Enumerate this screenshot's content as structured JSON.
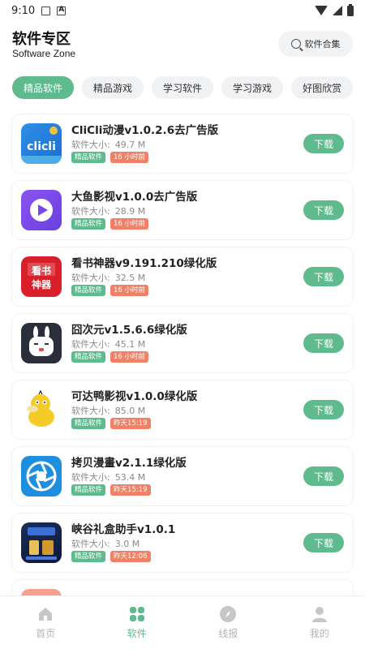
{
  "statusbar": {
    "time": "9:10"
  },
  "header": {
    "title": "软件专区",
    "subtitle": "Software Zone",
    "search_label": "软件合集"
  },
  "tabs": [
    {
      "label": "精品软件",
      "active": true
    },
    {
      "label": "精品游戏",
      "active": false
    },
    {
      "label": "学习软件",
      "active": false
    },
    {
      "label": "学习游戏",
      "active": false
    },
    {
      "label": "好图欣赏",
      "active": false
    }
  ],
  "apps": [
    {
      "name": "CliCli动漫v1.0.2.6去广告版",
      "size_label": "软件大小:",
      "size": "49.7 M",
      "category": "精品软件",
      "time": "16 小时前",
      "download": "下载",
      "icon": "clicli-icon"
    },
    {
      "name": "大鱼影视v1.0.0去广告版",
      "size_label": "软件大小:",
      "size": "28.9 M",
      "category": "精品软件",
      "time": "16 小时前",
      "download": "下载",
      "icon": "play-icon"
    },
    {
      "name": "看书神器v9.191.210绿化版",
      "size_label": "软件大小:",
      "size": "32.5 M",
      "category": "精品软件",
      "time": "16 小时前",
      "download": "下载",
      "icon": "book-icon"
    },
    {
      "name": "囧次元v1.5.6.6绿化版",
      "size_label": "软件大小:",
      "size": "45.1 M",
      "category": "精品软件",
      "time": "16 小时前",
      "download": "下载",
      "icon": "rabbit-icon"
    },
    {
      "name": "可达鸭影视v1.0.0绿化版",
      "size_label": "软件大小:",
      "size": "85.0 M",
      "category": "精品软件",
      "time": "昨天15:19",
      "download": "下载",
      "icon": "duck-icon"
    },
    {
      "name": "拷贝漫畫v2.1.1绿化版",
      "size_label": "软件大小:",
      "size": "53.4 M",
      "category": "精品软件",
      "time": "昨天15:19",
      "download": "下载",
      "icon": "aperture-icon"
    },
    {
      "name": "峡谷礼盒助手v1.0.1",
      "size_label": "软件大小:",
      "size": "3.0 M",
      "category": "精品软件",
      "time": "昨天12:06",
      "download": "下载",
      "icon": "giftbox-icon"
    }
  ],
  "bottom_nav": [
    {
      "label": "首页",
      "active": false,
      "icon": "home-icon"
    },
    {
      "label": "软件",
      "active": true,
      "icon": "grid-icon"
    },
    {
      "label": "线报",
      "active": false,
      "icon": "compass-icon"
    },
    {
      "label": "我的",
      "active": false,
      "icon": "user-icon"
    }
  ],
  "colors": {
    "accent": "#5fbb8d",
    "time_badge": "#ef8167"
  }
}
